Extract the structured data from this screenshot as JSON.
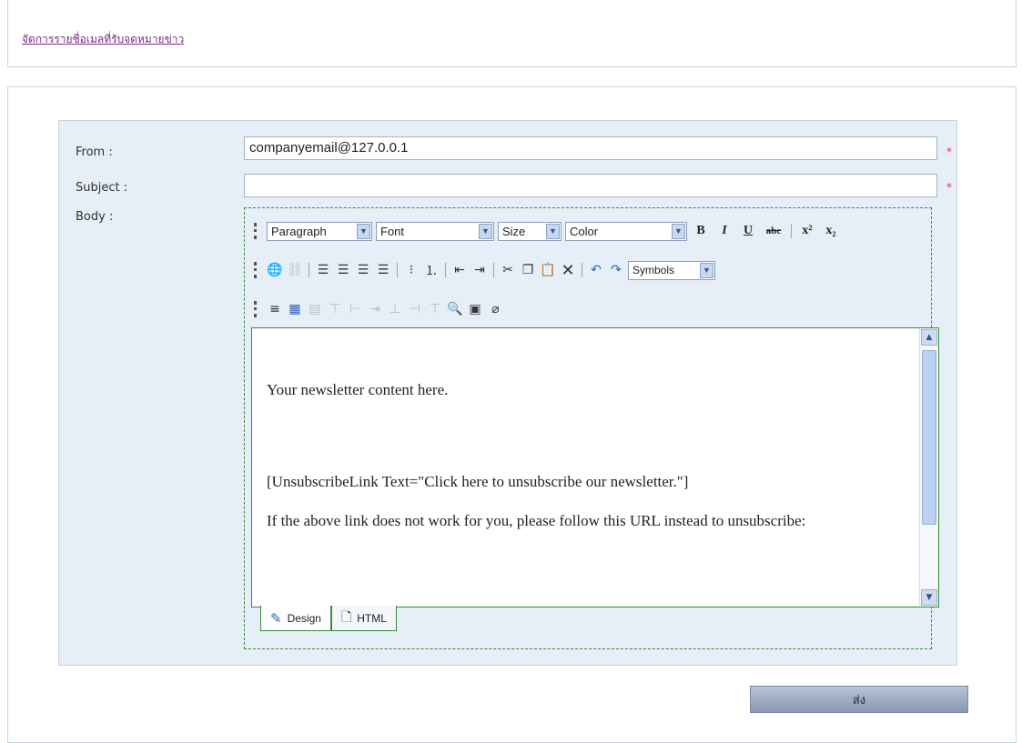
{
  "header": {
    "link_text": "จัดการรายชื่อเมลที่รับจดหมายข่าว"
  },
  "form": {
    "from_label": "From :",
    "from_value": "companyemail@127.0.0.1",
    "subject_label": "Subject :",
    "subject_value": "",
    "body_label": "Body :",
    "required_mark": "*"
  },
  "editor": {
    "toolbar": {
      "paragraph": "Paragraph",
      "font": "Font",
      "size": "Size",
      "color": "Color",
      "bold": "B",
      "italic": "I",
      "underline": "U",
      "strike": "abc",
      "superscript": "x²",
      "subscript": "x₂",
      "symbols": "Symbols"
    },
    "content": {
      "line1": "Your newsletter content here.",
      "line2": "[UnsubscribeLink Text=\"Click here to unsubscribe our newsletter.\"]",
      "line3": "If the above link does not work for you, please follow this URL instead to unsubscribe:"
    },
    "tabs": {
      "design": "Design",
      "html": "HTML"
    }
  },
  "actions": {
    "send_label": "ส่ง"
  },
  "colors": {
    "required": "#ee3333",
    "link": "#7d2a8a",
    "panel_bg": "#e6eef7",
    "editor_border": "#3a8a3a"
  }
}
